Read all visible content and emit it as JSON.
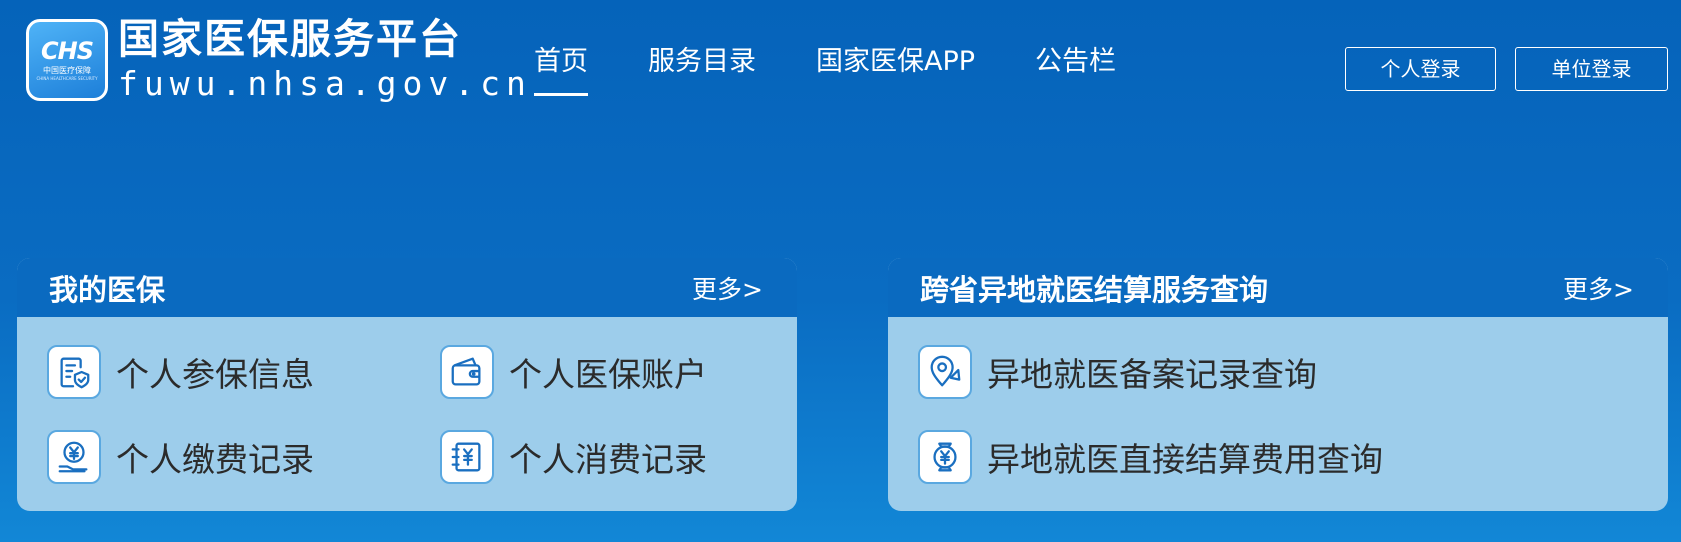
{
  "brand": {
    "logo_mark": "CHS",
    "logo_sub": "中国医疗保障",
    "logo_sub_en": "CHINA HEALTHCARE SECURITY",
    "title": "国家医保服务平台",
    "domain": "fuwu.nhsa.gov.cn"
  },
  "nav": {
    "items": [
      {
        "label": "首页",
        "active": true
      },
      {
        "label": "服务目录",
        "active": false
      },
      {
        "label": "国家医保APP",
        "active": false
      },
      {
        "label": "公告栏",
        "active": false
      }
    ]
  },
  "auth": {
    "person_login": "个人登录",
    "unit_login": "单位登录"
  },
  "cards": [
    {
      "title": "我的医保",
      "more": "更多>",
      "items": [
        {
          "label": "个人参保信息",
          "icon": "document-shield-icon"
        },
        {
          "label": "个人医保账户",
          "icon": "wallet-icon"
        },
        {
          "label": "个人缴费记录",
          "icon": "yuan-hand-icon"
        },
        {
          "label": "个人消费记录",
          "icon": "yuan-receipt-icon"
        }
      ]
    },
    {
      "title": "跨省异地就医结算服务查询",
      "more": "更多>",
      "items": [
        {
          "label": "异地就医备案记录查询",
          "icon": "location-pin-icon"
        },
        {
          "label": "异地就医直接结算费用查询",
          "icon": "yuan-coin-icon"
        }
      ]
    }
  ],
  "colors": {
    "background_top": "#0563ba",
    "background_bottom": "#1287d6",
    "card_header": "#0a6ac0",
    "card_body": "#9dcdeb",
    "icon_stroke": "#1a6fc0"
  }
}
